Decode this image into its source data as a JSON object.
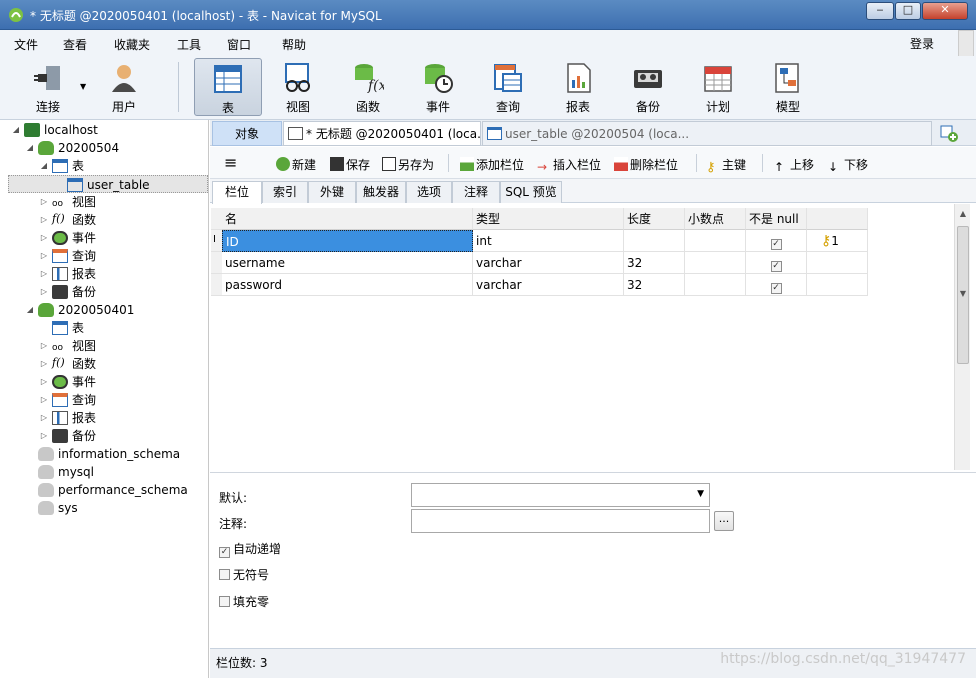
{
  "window": {
    "title": "* 无标题 @2020050401 (localhost) - 表 - Navicat for MySQL",
    "minimize": "‒",
    "maximize": "□",
    "close": "✕"
  },
  "menu": {
    "items": [
      "文件",
      "查看",
      "收藏夹",
      "工具",
      "窗口",
      "帮助"
    ],
    "login": "登录"
  },
  "toolbar": {
    "buttons": [
      {
        "label": "连接",
        "icon": "plug-icon"
      },
      {
        "label": "用户",
        "icon": "user-icon"
      },
      {
        "label": "表",
        "icon": "table-icon"
      },
      {
        "label": "视图",
        "icon": "view-glasses-icon"
      },
      {
        "label": "函数",
        "icon": "function-icon"
      },
      {
        "label": "事件",
        "icon": "event-clock-icon"
      },
      {
        "label": "查询",
        "icon": "query-icon"
      },
      {
        "label": "报表",
        "icon": "report-icon"
      },
      {
        "label": "备份",
        "icon": "backup-tape-icon"
      },
      {
        "label": "计划",
        "icon": "calendar-icon"
      },
      {
        "label": "模型",
        "icon": "model-icon"
      }
    ],
    "active": "表"
  },
  "tree": {
    "connection": "localhost",
    "db1": {
      "name": "20200504",
      "table_folder": "表",
      "table": "user_table",
      "folders": [
        "视图",
        "函数",
        "事件",
        "查询",
        "报表",
        "备份"
      ]
    },
    "db2": {
      "name": "2020050401",
      "table_folder": "表",
      "folders": [
        "视图",
        "函数",
        "事件",
        "查询",
        "报表",
        "备份"
      ]
    },
    "other_dbs": [
      "information_schema",
      "mysql",
      "performance_schema",
      "sys"
    ]
  },
  "tabs": {
    "object": "对象",
    "doc1": "* 无标题 @2020050401 (loca...",
    "doc2": "user_table @20200504 (loca..."
  },
  "edit_toolbar": {
    "menu": "≡",
    "new": "新建",
    "save": "保存",
    "save_as": "另存为",
    "add_field": "添加栏位",
    "insert_field": "插入栏位",
    "delete_field": "删除栏位",
    "primary_key": "主键",
    "move_up": "上移",
    "move_down": "下移"
  },
  "subtabs": [
    "栏位",
    "索引",
    "外键",
    "触发器",
    "选项",
    "注释",
    "SQL 预览"
  ],
  "grid": {
    "headers": [
      "名",
      "类型",
      "长度",
      "小数点",
      "不是 null",
      ""
    ],
    "rows": [
      {
        "name": "ID",
        "type": "int",
        "length": "",
        "decimal": "",
        "not_null": true,
        "key": "1"
      },
      {
        "name": "username",
        "type": "varchar",
        "length": "32",
        "decimal": "",
        "not_null": true,
        "key": ""
      },
      {
        "name": "password",
        "type": "varchar",
        "length": "32",
        "decimal": "",
        "not_null": true,
        "key": ""
      }
    ]
  },
  "props": {
    "default_label": "默认:",
    "comment_label": "注释:",
    "comment_btn": "...",
    "auto_increment": {
      "label": "自动递增",
      "checked": true
    },
    "unsigned": {
      "label": "无符号",
      "checked": false
    },
    "zerofill": {
      "label": "填充零",
      "checked": false
    }
  },
  "status": {
    "field_count": "栏位数: 3",
    "watermark": "https://blog.csdn.net/qq_31947477"
  }
}
